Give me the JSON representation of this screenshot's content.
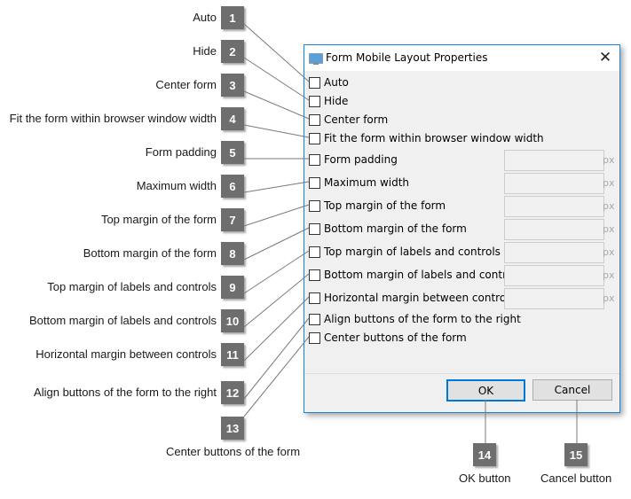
{
  "dialog": {
    "title": "Form Mobile Layout Properties",
    "app_icon": "window-icon",
    "close_glyph": "✕",
    "options": [
      {
        "label": "Auto",
        "checked": false,
        "has_field": false
      },
      {
        "label": "Hide",
        "checked": false,
        "has_field": false
      },
      {
        "label": "Center form",
        "checked": false,
        "has_field": false
      },
      {
        "label": "Fit the form within browser window width",
        "checked": false,
        "has_field": false
      },
      {
        "label": "Form padding",
        "checked": false,
        "has_field": true,
        "value": "",
        "unit": "px"
      },
      {
        "label": "Maximum width",
        "checked": false,
        "has_field": true,
        "value": "",
        "unit": "px"
      },
      {
        "label": "Top margin of the form",
        "checked": false,
        "has_field": true,
        "value": "",
        "unit": "px"
      },
      {
        "label": "Bottom margin of the form",
        "checked": false,
        "has_field": true,
        "value": "",
        "unit": "px"
      },
      {
        "label": "Top margin of labels and controls",
        "checked": false,
        "has_field": true,
        "value": "",
        "unit": "px"
      },
      {
        "label": "Bottom margin of labels and controls",
        "checked": false,
        "has_field": true,
        "value": "",
        "unit": "px"
      },
      {
        "label": "Horizontal margin between controls",
        "checked": false,
        "has_field": true,
        "value": "",
        "unit": "px"
      },
      {
        "label": "Align buttons of the form to the right",
        "checked": false,
        "has_field": false
      },
      {
        "label": "Center buttons of the form",
        "checked": false,
        "has_field": false
      }
    ],
    "ok_label": "OK",
    "cancel_label": "Cancel"
  },
  "callouts": [
    {
      "number": "1",
      "label": "Auto"
    },
    {
      "number": "2",
      "label": "Hide"
    },
    {
      "number": "3",
      "label": "Center form"
    },
    {
      "number": "4",
      "label": "Fit the form within browser window width"
    },
    {
      "number": "5",
      "label": "Form padding"
    },
    {
      "number": "6",
      "label": "Maximum width"
    },
    {
      "number": "7",
      "label": "Top margin of the form"
    },
    {
      "number": "8",
      "label": "Bottom margin of the form"
    },
    {
      "number": "9",
      "label": "Top margin of labels and controls"
    },
    {
      "number": "10",
      "label": "Bottom margin of labels and controls"
    },
    {
      "number": "11",
      "label": "Horizontal margin between controls"
    },
    {
      "number": "12",
      "label": "Align buttons of the form to the right"
    },
    {
      "number": "13",
      "label": "Center buttons of the form"
    },
    {
      "number": "14",
      "label": "OK button"
    },
    {
      "number": "15",
      "label": "Cancel button"
    }
  ],
  "colors": {
    "badge": "#6e6e6e",
    "dialog_border": "#1883d7",
    "ok_border": "#0078d7",
    "dialog_bg": "#f0f0f0"
  }
}
